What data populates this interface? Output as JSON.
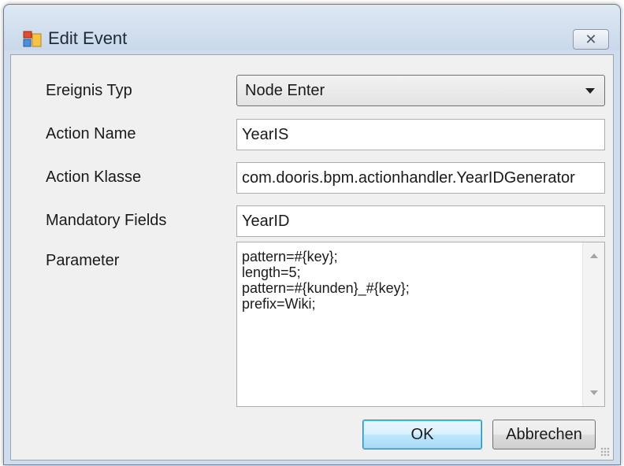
{
  "window": {
    "title": "Edit Event",
    "close_glyph": "✕"
  },
  "form": {
    "event_type": {
      "label": "Ereignis Typ",
      "value": "Node Enter"
    },
    "action_name": {
      "label": "Action Name",
      "value": "YearIS"
    },
    "action_class": {
      "label": "Action Klasse",
      "value": "com.dooris.bpm.actionhandler.YearIDGenerator"
    },
    "mandatory_fields": {
      "label": "Mandatory Fields",
      "value": "YearID"
    },
    "parameter": {
      "label": "Parameter",
      "lines": [
        "pattern=#{key};",
        "length=5;",
        "pattern=#{kunden}_#{key};",
        "prefix=Wiki;"
      ]
    }
  },
  "buttons": {
    "ok": "OK",
    "cancel": "Abbrechen"
  },
  "icons": {
    "app": "form-window-icon",
    "close": "close-icon",
    "dropdown": "chevron-down-icon",
    "scroll_up": "scroll-up-arrow-icon",
    "scroll_down": "scroll-down-arrow-icon",
    "resize": "resize-grip-icon"
  }
}
